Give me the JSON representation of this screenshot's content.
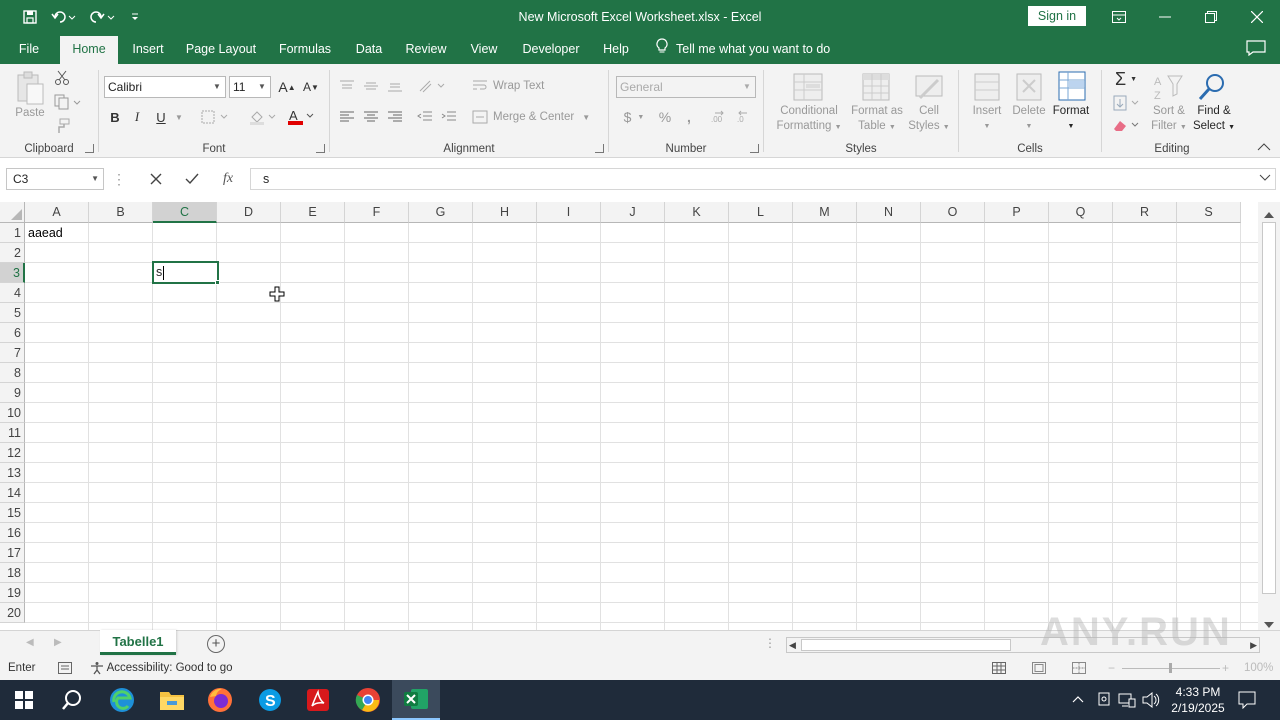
{
  "window": {
    "title": "New Microsoft Excel Worksheet.xlsx  -  Excel",
    "sign_in": "Sign in"
  },
  "tabs": [
    "File",
    "Home",
    "Insert",
    "Page Layout",
    "Formulas",
    "Data",
    "Review",
    "View",
    "Developer",
    "Help"
  ],
  "active_tab": "Home",
  "tell_me": "Tell me what you want to do",
  "ribbon": {
    "clipboard": {
      "label": "Clipboard",
      "paste": "Paste"
    },
    "font": {
      "label": "Font",
      "font_name": "Calibri",
      "font_size": "11",
      "bold": "B",
      "italic": "I",
      "underline": "U",
      "font_color": "#e00000"
    },
    "alignment": {
      "label": "Alignment",
      "wrap_text": "Wrap Text",
      "merge_center": "Merge & Center"
    },
    "number": {
      "label": "Number",
      "format": "General",
      "currency": "$",
      "percent": "%",
      "comma": ","
    },
    "styles": {
      "label": "Styles",
      "conditional_1": "Conditional",
      "conditional_2": "Formatting",
      "format_table_1": "Format as",
      "format_table_2": "Table",
      "cell_styles_1": "Cell",
      "cell_styles_2": "Styles"
    },
    "cells": {
      "label": "Cells",
      "insert": "Insert",
      "delete": "Delete",
      "format": "Format"
    },
    "editing": {
      "label": "Editing",
      "sort_1": "Sort &",
      "sort_2": "Filter",
      "find_1": "Find &",
      "find_2": "Select"
    }
  },
  "formula_bar": {
    "name_box": "C3",
    "fx": "fx",
    "content": "s"
  },
  "columns": [
    "A",
    "B",
    "C",
    "D",
    "E",
    "F",
    "G",
    "H",
    "I",
    "J",
    "K",
    "L",
    "M",
    "N",
    "O",
    "P",
    "Q",
    "R",
    "S"
  ],
  "rows": [
    "1",
    "2",
    "3",
    "4",
    "5",
    "6",
    "7",
    "8",
    "9",
    "10",
    "11",
    "12",
    "13",
    "14",
    "15",
    "16",
    "17",
    "18",
    "19",
    "20"
  ],
  "cells": {
    "A1": "aaead",
    "C3": "s"
  },
  "sheet": {
    "tab": "Tabelle1"
  },
  "status": {
    "mode": "Enter",
    "accessibility": "Accessibility: Good to go",
    "zoom": "100%"
  },
  "watermark": "ANY.RUN",
  "taskbar": {
    "time": "4:33 PM",
    "date": "2/19/2025"
  }
}
